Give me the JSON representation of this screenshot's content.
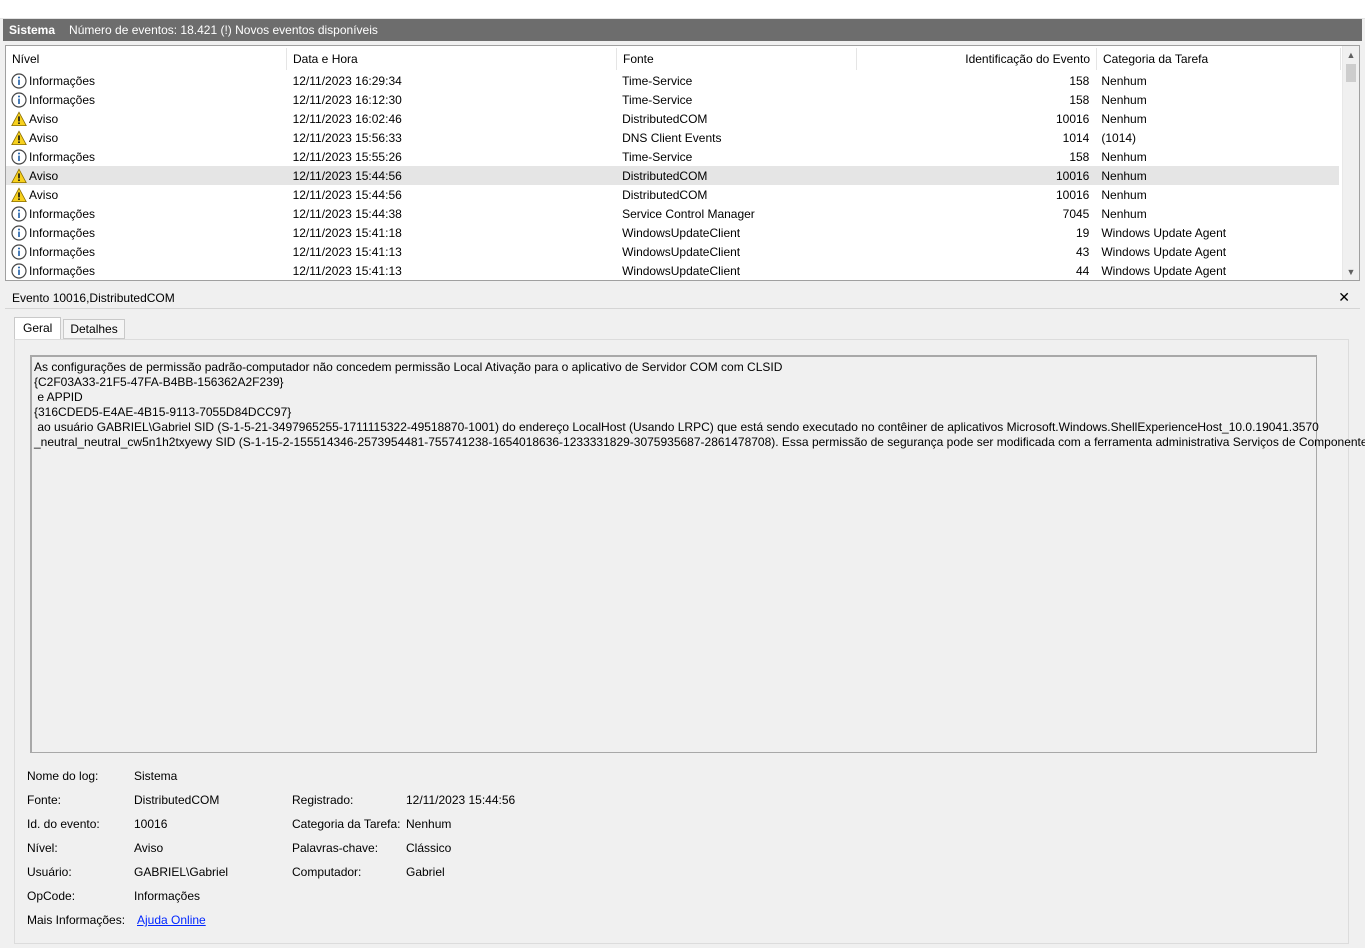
{
  "title_bar": {
    "log_name": "Sistema",
    "summary": "Número de eventos: 18.421 (!) Novos eventos disponíveis"
  },
  "grid": {
    "columns": [
      "Nível",
      "Data e Hora",
      "Fonte",
      "Identificação do Evento",
      "Categoria da Tarefa"
    ],
    "rows": [
      {
        "level": "Informações",
        "icon": "info-icon",
        "date": "12/11/2023 16:29:34",
        "source": "Time-Service",
        "id": "158",
        "category": "Nenhum"
      },
      {
        "level": "Informações",
        "icon": "info-icon",
        "date": "12/11/2023 16:12:30",
        "source": "Time-Service",
        "id": "158",
        "category": "Nenhum"
      },
      {
        "level": "Aviso",
        "icon": "warning-icon",
        "date": "12/11/2023 16:02:46",
        "source": "DistributedCOM",
        "id": "10016",
        "category": "Nenhum"
      },
      {
        "level": "Aviso",
        "icon": "warning-icon",
        "date": "12/11/2023 15:56:33",
        "source": "DNS Client Events",
        "id": "1014",
        "category": "(1014)"
      },
      {
        "level": "Informações",
        "icon": "info-icon",
        "date": "12/11/2023 15:55:26",
        "source": "Time-Service",
        "id": "158",
        "category": "Nenhum"
      },
      {
        "level": "Aviso",
        "icon": "warning-icon",
        "date": "12/11/2023 15:44:56",
        "source": "DistributedCOM",
        "id": "10016",
        "category": "Nenhum"
      },
      {
        "level": "Aviso",
        "icon": "warning-icon",
        "date": "12/11/2023 15:44:56",
        "source": "DistributedCOM",
        "id": "10016",
        "category": "Nenhum"
      },
      {
        "level": "Informações",
        "icon": "info-icon",
        "date": "12/11/2023 15:44:38",
        "source": "Service Control Manager",
        "id": "7045",
        "category": "Nenhum"
      },
      {
        "level": "Informações",
        "icon": "info-icon",
        "date": "12/11/2023 15:41:18",
        "source": "WindowsUpdateClient",
        "id": "19",
        "category": "Windows Update Agent"
      },
      {
        "level": "Informações",
        "icon": "info-icon",
        "date": "12/11/2023 15:41:13",
        "source": "WindowsUpdateClient",
        "id": "43",
        "category": "Windows Update Agent"
      },
      {
        "level": "Informações",
        "icon": "info-icon",
        "date": "12/11/2023 15:41:13",
        "source": "WindowsUpdateClient",
        "id": "44",
        "category": "Windows Update Agent"
      }
    ],
    "selected_row": 5
  },
  "detail": {
    "header": "Evento 10016,DistributedCOM",
    "tabs": [
      "Geral",
      "Detalhes"
    ],
    "message_lines": [
      "As configurações de permissão padrão-computador não concedem permissão Local Ativação para o aplicativo de Servidor COM com CLSID",
      "{C2F03A33-21F5-47FA-B4BB-156362A2F239}",
      " e APPID",
      "{316CDED5-E4AE-4B15-9113-7055D84DCC97}",
      " ao usuário GABRIEL\\Gabriel SID (S-1-5-21-3497965255-1711115322-49518870-1001) do endereço LocalHost (Usando LRPC) que está sendo executado no contêiner de aplicativos Microsoft.Windows.ShellExperienceHost_10.0.19041.3570",
      "_neutral_neutral_cw5n1h2txyewy SID (S-1-15-2-155514346-2573954481-755741238-1654018636-1233331829-3075935687-2861478708). Essa permissão de segurança pode ser modificada com a ferramenta administrativa Serviços de Componentes."
    ],
    "props": {
      "log_name_label": "Nome do log:",
      "log_name": "Sistema",
      "source_label": "Fonte:",
      "source": "DistributedCOM",
      "registered_label": "Registrado:",
      "registered": "12/11/2023 15:44:56",
      "event_id_label": "Id. do evento:",
      "event_id": "10016",
      "task_category_label": "Categoria da Tarefa:",
      "task_category": "Nenhum",
      "level_label": "Nível:",
      "level": "Aviso",
      "keywords_label": "Palavras-chave:",
      "keywords": "Clássico",
      "user_label": "Usuário:",
      "user": "GABRIEL\\Gabriel",
      "computer_label": "Computador:",
      "computer": "Gabriel",
      "opcode_label": "OpCode:",
      "opcode": "Informações",
      "more_info_label": "Mais Informações:",
      "more_info_link": "Ajuda Online"
    }
  },
  "colors": {
    "titlebar_bg": "#6d6d6d",
    "selected_row_bg": "#e5e5e5",
    "link": "#0026ff",
    "warning_yellow": "#f7d11e",
    "info_blue": "#1f5fa8"
  }
}
